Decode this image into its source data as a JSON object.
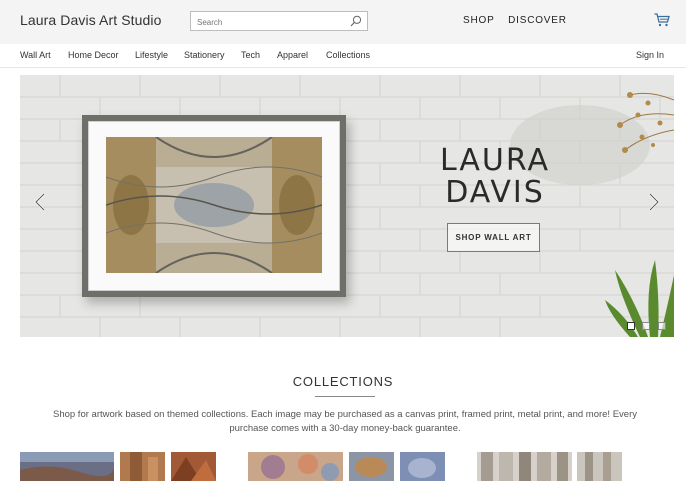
{
  "header": {
    "brand": "Laura Davis Art Studio",
    "search_placeholder": "Search",
    "nav": [
      "SHOP",
      "DISCOVER"
    ],
    "cart_icon": "cart-icon"
  },
  "categories": [
    "Wall Art",
    "Home Decor",
    "Lifestyle",
    "Stationery",
    "Tech",
    "Apparel",
    "Collections"
  ],
  "sign_in": "Sign In",
  "hero": {
    "title_line1": "LAURA",
    "title_line2": "DAVIS",
    "button": "SHOP WALL ART",
    "slides": 3,
    "active_slide": 1
  },
  "collections": {
    "title": "COLLECTIONS",
    "description": "Shop for artwork based on themed collections. Each image may be purchased as a canvas print, framed print, metal print, and more! Every purchase comes with a 30-day money-back guarantee."
  }
}
